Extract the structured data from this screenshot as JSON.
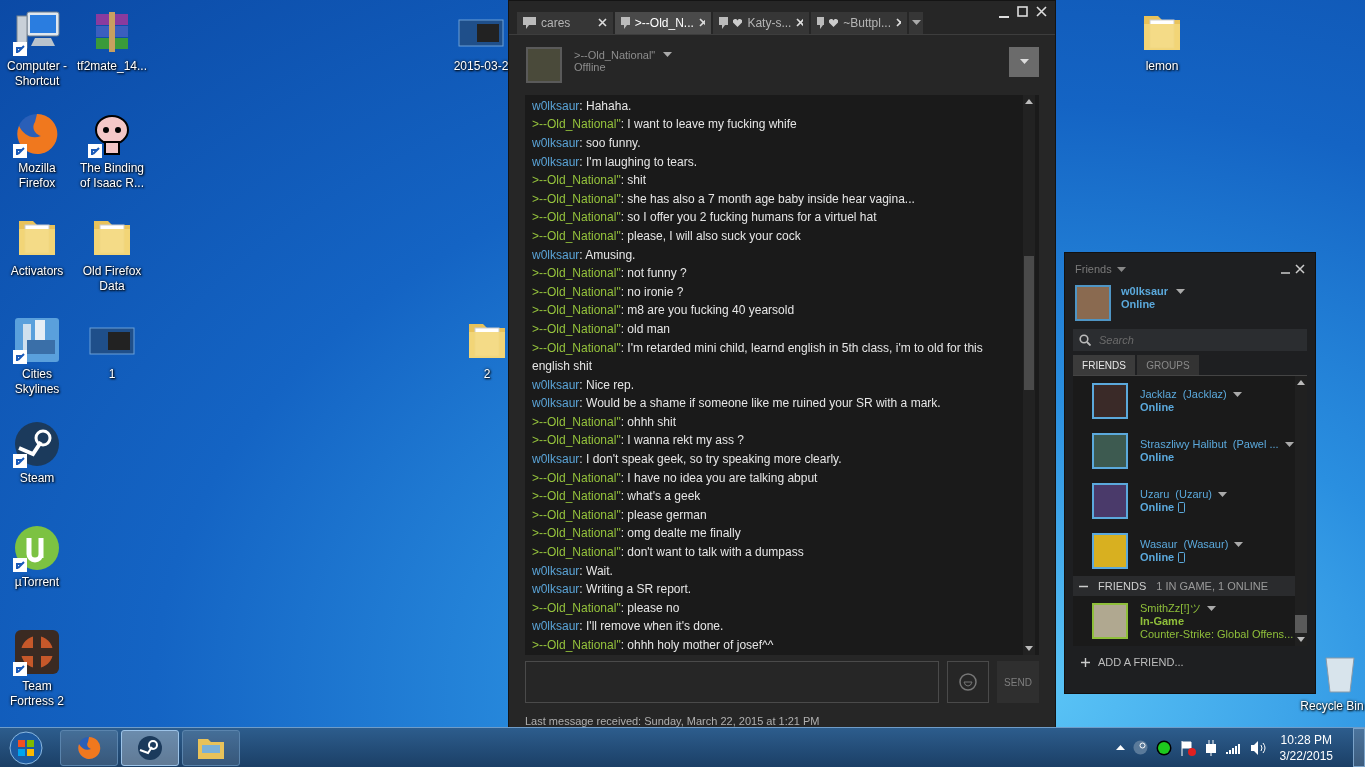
{
  "desktop_icons": [
    {
      "label": "Computer - Shortcut",
      "kind": "computer",
      "shortcut": true
    },
    {
      "label": "tf2mate_14...",
      "kind": "archive",
      "shortcut": false
    },
    {
      "label": "Mozilla Firefox",
      "kind": "firefox",
      "shortcut": true
    },
    {
      "label": "The Binding of Isaac R...",
      "kind": "isaac",
      "shortcut": true
    },
    {
      "label": "Activators",
      "kind": "folder",
      "shortcut": false
    },
    {
      "label": "Old Firefox Data",
      "kind": "folder",
      "shortcut": false
    },
    {
      "label": "Cities Skylines",
      "kind": "cities",
      "shortcut": true
    },
    {
      "label": "1",
      "kind": "image",
      "shortcut": false
    },
    {
      "label": "Steam",
      "kind": "steam",
      "shortcut": true
    },
    {
      "label": "µTorrent",
      "kind": "utorrent",
      "shortcut": true
    },
    {
      "label": "Team Fortress 2",
      "kind": "tf2",
      "shortcut": true
    },
    {
      "label": "2015-03-2",
      "kind": "image",
      "shortcut": false
    },
    {
      "label": "2",
      "kind": "folder",
      "shortcut": false
    },
    {
      "label": "lemon",
      "kind": "folder",
      "shortcut": false
    },
    {
      "label": "Recycle Bin",
      "kind": "bin",
      "shortcut": false
    }
  ],
  "chat_window": {
    "tabs": [
      {
        "label": "cares",
        "favorite": false,
        "selected": false
      },
      {
        "label": ">--Old_N...",
        "favorite": false,
        "selected": true
      },
      {
        "label": "Katy-s...",
        "favorite": true,
        "selected": false
      },
      {
        "label": "~Buttpl...",
        "favorite": true,
        "selected": false
      }
    ],
    "contact": {
      "name": ">--Old_National\"",
      "status": "Offline"
    },
    "messages": [
      {
        "kind": "self",
        "sender": "w0lksaur",
        "text": ": Hahaha."
      },
      {
        "kind": "other",
        "sender": ">--Old_National\"",
        "text": ": I want to leave my fucking whife"
      },
      {
        "kind": "self",
        "sender": "w0lksaur",
        "text": ": soo funny."
      },
      {
        "kind": "self",
        "sender": "w0lksaur",
        "text": ": I'm laughing to tears."
      },
      {
        "kind": "other",
        "sender": ">--Old_National\"",
        "text": ": shit"
      },
      {
        "kind": "other",
        "sender": ">--Old_National\"",
        "text": ": she has also a 7 month age baby inside hear vagina..."
      },
      {
        "kind": "other",
        "sender": ">--Old_National\"",
        "text": ": so I offer you 2 fucking humans for a virtuel hat"
      },
      {
        "kind": "other",
        "sender": ">--Old_National\"",
        "text": ": please, I will also suck your cock"
      },
      {
        "kind": "self",
        "sender": "w0lksaur",
        "text": ": Amusing."
      },
      {
        "kind": "other",
        "sender": ">--Old_National\"",
        "text": ": not funny ?"
      },
      {
        "kind": "other",
        "sender": ">--Old_National\"",
        "text": ": no ironie ?"
      },
      {
        "kind": "other",
        "sender": ">--Old_National\"",
        "text": ": m8 are you fucking 40 yearsold"
      },
      {
        "kind": "other",
        "sender": ">--Old_National\"",
        "text": ": old man"
      },
      {
        "kind": "other",
        "sender": ">--Old_National\"",
        "text": ": I'm retarded mini child, learnd english in 5th class, i'm to old for this  english shit"
      },
      {
        "kind": "self",
        "sender": "w0lksaur",
        "text": ": Nice rep."
      },
      {
        "kind": "self",
        "sender": "w0lksaur",
        "text": ": Would be a shame if someone like me ruined your SR with a mark."
      },
      {
        "kind": "other",
        "sender": ">--Old_National\"",
        "text": ": ohhh shit"
      },
      {
        "kind": "other",
        "sender": ">--Old_National\"",
        "text": ": I wanna rekt my ass ?"
      },
      {
        "kind": "self",
        "sender": "w0lksaur",
        "text": ": I don't speak geek, so try speaking more clearly."
      },
      {
        "kind": "other",
        "sender": ">--Old_National\"",
        "text": ": I have no idea you are talking abput"
      },
      {
        "kind": "other",
        "sender": ">--Old_National\"",
        "text": ": what's a geek"
      },
      {
        "kind": "other",
        "sender": ">--Old_National\"",
        "text": ": please german"
      },
      {
        "kind": "other",
        "sender": ">--Old_National\"",
        "text": ": omg dealte me finally"
      },
      {
        "kind": "other",
        "sender": ">--Old_National\"",
        "text": ": don't want to talk with a dumpass"
      },
      {
        "kind": "self",
        "sender": "w0lksaur",
        "text": ": Wait."
      },
      {
        "kind": "self",
        "sender": "w0lksaur",
        "text": ": Writing a SR report."
      },
      {
        "kind": "other",
        "sender": ">--Old_National\"",
        "text": ": please no"
      },
      {
        "kind": "self",
        "sender": "w0lksaur",
        "text": ": I'll remove when it's done."
      },
      {
        "kind": "other",
        "sender": ">--Old_National\"",
        "text": ": ohhh holy mother of josef^^"
      }
    ],
    "send_label": "SEND",
    "footer": "Last message received: Sunday, March 22, 2015 at 1:21 PM"
  },
  "friends_window": {
    "title": "Friends",
    "user": {
      "name": "w0lksaur",
      "status": "Online"
    },
    "search_placeholder": "Search",
    "tabs": [
      {
        "label": "FRIENDS",
        "selected": true
      },
      {
        "label": "GROUPS",
        "selected": false
      }
    ],
    "friends": [
      {
        "kind": "online",
        "name": "Jacklaz",
        "nickname": "(Jacklaz)",
        "status": "Online",
        "mobile": false
      },
      {
        "kind": "online",
        "name": "Straszliwy Halibut",
        "nickname": "(Pawel ...",
        "status": "Online",
        "mobile": false
      },
      {
        "kind": "online",
        "name": "Uzaru",
        "nickname": "(Uzaru)",
        "status": "Online",
        "mobile": true
      },
      {
        "kind": "online",
        "name": "Wasaur",
        "nickname": "(Wasaur)",
        "status": "Online",
        "mobile": true
      }
    ],
    "group": {
      "title": "FRIENDS",
      "summary": "1 IN GAME, 1 ONLINE",
      "expanded": true,
      "friends": [
        {
          "kind": "ingame",
          "name": "SmithZz[!]ツ",
          "status": "In-Game",
          "game": "Counter-Strike: Global Offens..."
        }
      ]
    },
    "add_friend": "ADD A FRIEND..."
  },
  "taskbar": {
    "pinned": [
      {
        "kind": "firefox",
        "active": false
      },
      {
        "kind": "steam",
        "active": true
      },
      {
        "kind": "explorer",
        "active": false
      }
    ],
    "tray": [
      {
        "kind": "show-hidden"
      },
      {
        "kind": "steam"
      },
      {
        "kind": "cloud"
      },
      {
        "kind": "flag"
      },
      {
        "kind": "power"
      },
      {
        "kind": "signal"
      },
      {
        "kind": "volume"
      }
    ],
    "time": "10:28 PM",
    "date": "3/22/2015"
  }
}
